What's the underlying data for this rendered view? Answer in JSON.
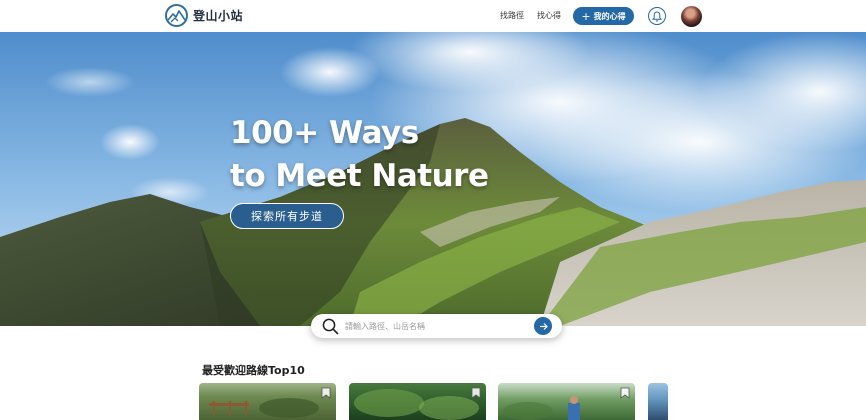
{
  "header": {
    "logo_text": "登山小站",
    "nav": {
      "find_trail": "找路徑",
      "find_notes": "找心得"
    },
    "my_notes_button": "我的心得"
  },
  "hero": {
    "title_line1": "100+ Ways",
    "title_line2": "to Meet Nature",
    "explore_button": "探索所有步道"
  },
  "search": {
    "placeholder": "請輸入路徑、山岳名稱"
  },
  "popular": {
    "title": "最受歡迎路線Top10"
  },
  "colors": {
    "primary": "#2468a6",
    "hero_button": "#2a5e8f"
  },
  "icons": [
    "mountain-logo-icon",
    "plus-icon",
    "bell-icon",
    "search-icon",
    "arrow-right-icon",
    "bookmark-icon"
  ]
}
